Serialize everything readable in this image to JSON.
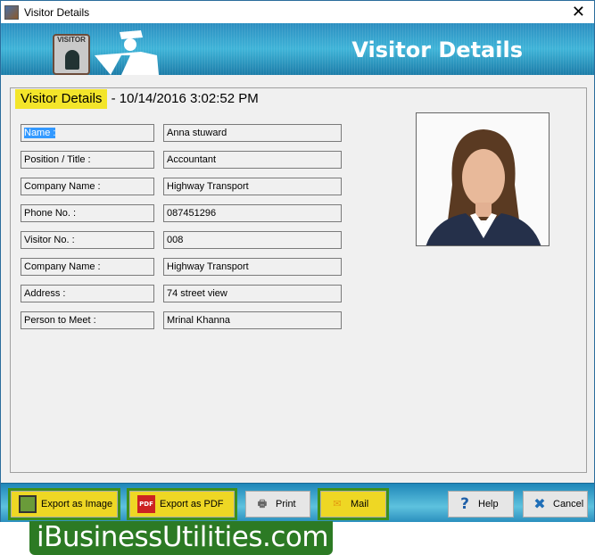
{
  "window": {
    "title": "Visitor Details",
    "close": "✕"
  },
  "banner": {
    "title": "Visitor Details",
    "badge_text": "VISITOR"
  },
  "header": {
    "title": "Visitor Details",
    "separator": " - ",
    "datetime": "10/14/2016 3:02:52 PM"
  },
  "fields": [
    {
      "label": "Name :",
      "value": "Anna stuward"
    },
    {
      "label": "Position / Title :",
      "value": "Accountant"
    },
    {
      "label": "Company Name :",
      "value": "Highway Transport"
    },
    {
      "label": "Phone No. :",
      "value": "087451296"
    },
    {
      "label": "Visitor No. :",
      "value": "008"
    },
    {
      "label": "Company Name :",
      "value": "Highway Transport"
    },
    {
      "label": "Address :",
      "value": "74 street view"
    },
    {
      "label": "Person to Meet :",
      "value": "Mrinal Khanna"
    }
  ],
  "buttons": {
    "export_image": "Export as Image",
    "export_pdf": "Export as PDF",
    "print": "Print",
    "mail": "Mail",
    "help": "Help",
    "cancel": "Cancel"
  },
  "logo": "iBusinessUtilities.com",
  "colors": {
    "highlight": "#f3e52a",
    "banner": "#2c8ec0",
    "logo_bg": "#2c7a24"
  }
}
